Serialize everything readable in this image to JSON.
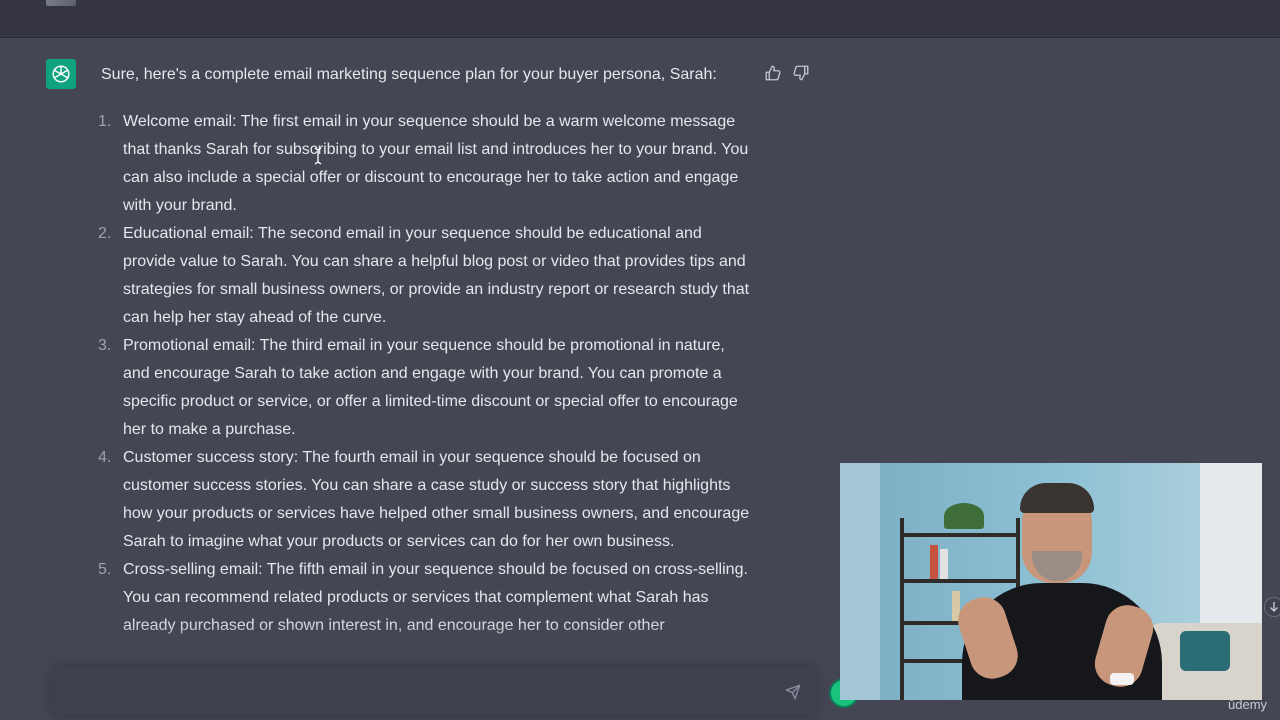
{
  "conversation": {
    "intro": "Sure, here's a complete email marketing sequence plan for your buyer persona, Sarah:",
    "items": [
      {
        "number": "1.",
        "text": "Welcome email: The first email in your sequence should be a warm welcome message that thanks Sarah for subscribing to your email list and introduces her to your brand. You can also include a special offer or discount to encourage her to take action and engage with your brand."
      },
      {
        "number": "2.",
        "text": "Educational email: The second email in your sequence should be educational and provide value to Sarah. You can share a helpful blog post or video that provides tips and strategies for small business owners, or provide an industry report or research study that can help her stay ahead of the curve."
      },
      {
        "number": "3.",
        "text": "Promotional email: The third email in your sequence should be promotional in nature, and encourage Sarah to take action and engage with your brand. You can promote a specific product or service, or offer a limited-time discount or special offer to encourage her to make a purchase."
      },
      {
        "number": "4.",
        "text": "Customer success story: The fourth email in your sequence should be focused on customer success stories. You can share a case study or success story that highlights how your products or services have helped other small business owners, and encourage Sarah to imagine what your products or services can do for her own business."
      },
      {
        "number": "5.",
        "text": "Cross-selling email: The fifth email in your sequence should be focused on cross-selling. You can recommend related products or services that complement what Sarah has already purchased or shown interest in, and encourage her to consider other"
      }
    ]
  },
  "icons": {
    "assistant_avatar": "chatgpt-logo-icon",
    "thumbs_up": "thumbs-up-icon",
    "thumbs_down": "thumbs-down-icon",
    "send": "send-icon",
    "text_cursor": "text-cursor-icon",
    "scroll_down": "arrow-down-icon"
  },
  "composer": {
    "value": "",
    "placeholder": ""
  },
  "overlay": {
    "watermark": "ūdemy"
  },
  "colors": {
    "background": "#444654",
    "user_strip": "#343541",
    "assistant_avatar": "#10a37f",
    "text": "#e5e7eb",
    "composer": "#40414f"
  }
}
